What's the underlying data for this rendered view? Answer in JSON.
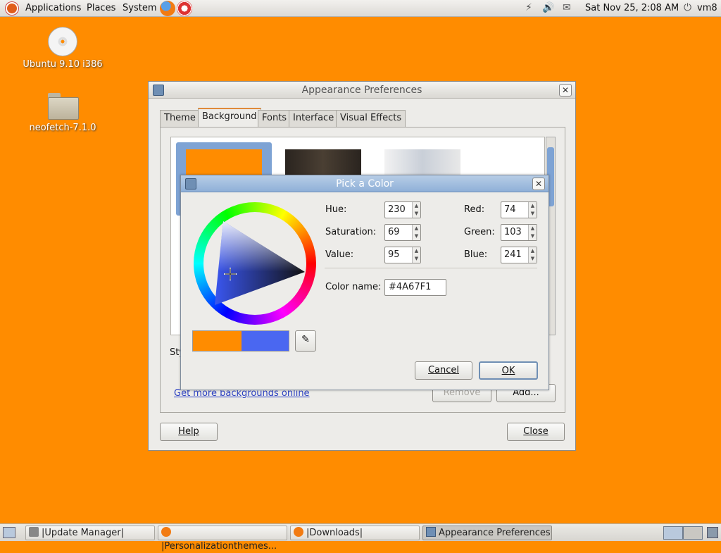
{
  "top_panel": {
    "menus": [
      "Applications",
      "Places",
      "System"
    ],
    "datetime": "Sat Nov 25,  2:08 AM",
    "user": "vm8"
  },
  "desktop": {
    "icons": [
      {
        "label": "Ubuntu 9.10 i386"
      },
      {
        "label": "neofetch-7.1.0"
      }
    ]
  },
  "appearance": {
    "title": "Appearance Preferences",
    "tabs": [
      "Theme",
      "Background",
      "Fonts",
      "Interface",
      "Visual Effects"
    ],
    "active_tab": "Background",
    "style_label_partial": "Sty",
    "more_link": "Get more backgrounds online",
    "remove_label": "Remove",
    "add_label": "Add...",
    "help_label": "Help",
    "close_label": "Close",
    "selected_color": "#ff8c00"
  },
  "picker": {
    "title": "Pick a Color",
    "hue_label": "Hue:",
    "hue": "230",
    "saturation_label": "Saturation:",
    "saturation": "69",
    "value_label": "Value:",
    "value": "95",
    "red_label": "Red:",
    "red": "74",
    "green_label": "Green:",
    "green": "103",
    "blue_label": "Blue:",
    "blue": "241",
    "color_name_label": "Color name:",
    "color_name": "#4A67F1",
    "cancel_label": "Cancel",
    "ok_label": "OK",
    "old_color": "#ff8c00",
    "new_color": "#4a67f1"
  },
  "taskbar": {
    "tasks": [
      "|Update Manager|",
      "|Personalizationthemes...",
      "|Downloads|",
      "Appearance Preferences"
    ]
  }
}
